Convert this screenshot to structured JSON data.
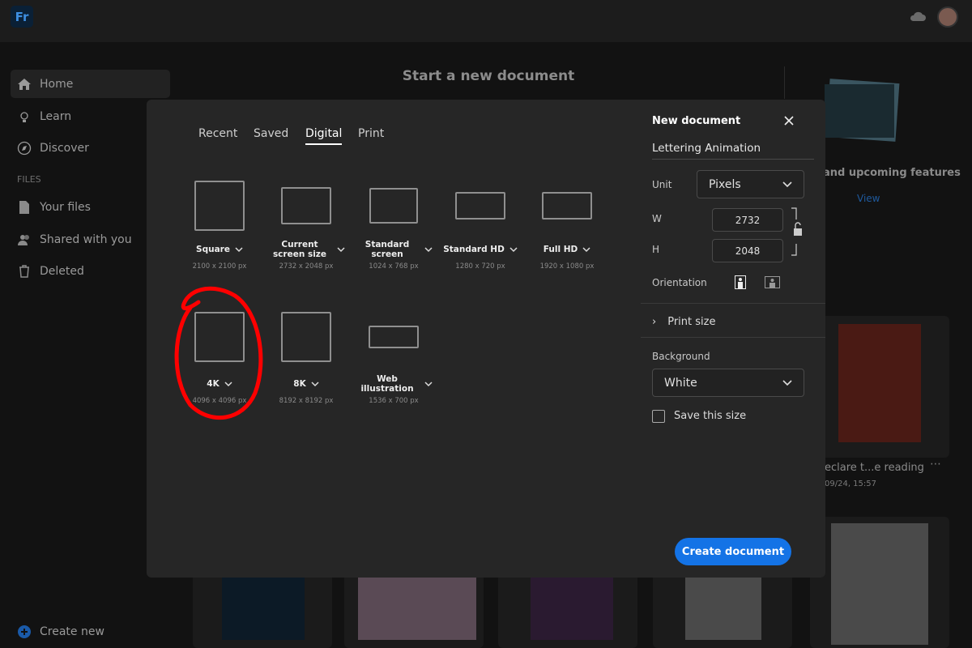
{
  "app": {
    "logo": "Fr",
    "cloud_icon": "cloud-icon",
    "avatar": "avatar"
  },
  "sidebar": {
    "items": [
      {
        "label": "Home",
        "icon": "home-icon"
      },
      {
        "label": "Learn",
        "icon": "lightbulb-icon"
      },
      {
        "label": "Discover",
        "icon": "compass-icon"
      }
    ],
    "files_header": "FILES",
    "files": [
      {
        "label": "Your files",
        "icon": "file-icon"
      },
      {
        "label": "Shared with you",
        "icon": "people-icon"
      },
      {
        "label": "Deleted",
        "icon": "trash-icon"
      }
    ],
    "create_new": "Create new"
  },
  "background": {
    "title": "Start a new document",
    "features_text": "and upcoming features",
    "view_link": "View",
    "recent_card": {
      "name": "eclare t...e reading",
      "date": "09/24, 15:57"
    }
  },
  "modal": {
    "tabs": [
      {
        "label": "Recent"
      },
      {
        "label": "Saved"
      },
      {
        "label": "Digital",
        "selected": true
      },
      {
        "label": "Print"
      }
    ],
    "presets": [
      {
        "label": "Square",
        "size": "2100 x 2100 px"
      },
      {
        "label": "Current screen size",
        "size": "2732 x 2048 px"
      },
      {
        "label": "Standard screen",
        "size": "1024 x 768 px"
      },
      {
        "label": "Standard HD",
        "size": "1280 x 720 px"
      },
      {
        "label": "Full HD",
        "size": "1920 x 1080 px"
      },
      {
        "label": "4K",
        "size": "4096 x 4096 px",
        "annotated": true
      },
      {
        "label": "8K",
        "size": "8192 x 8192 px"
      },
      {
        "label": "Web illustration",
        "size": "1536 x 700 px"
      }
    ],
    "panel": {
      "title": "New document",
      "name": "Lettering Animation",
      "unit_label": "Unit",
      "unit": "Pixels",
      "w_label": "W",
      "w": "2732",
      "h_label": "H",
      "h": "2048",
      "orientation_label": "Orientation",
      "orientation": "portrait",
      "print_size": "Print size",
      "background_label": "Background",
      "background": "White",
      "save_size": "Save this size",
      "save_size_checked": false
    },
    "create_button": "Create document"
  },
  "colors": {
    "accent": "#1473e6",
    "annotation": "#ff0000"
  }
}
